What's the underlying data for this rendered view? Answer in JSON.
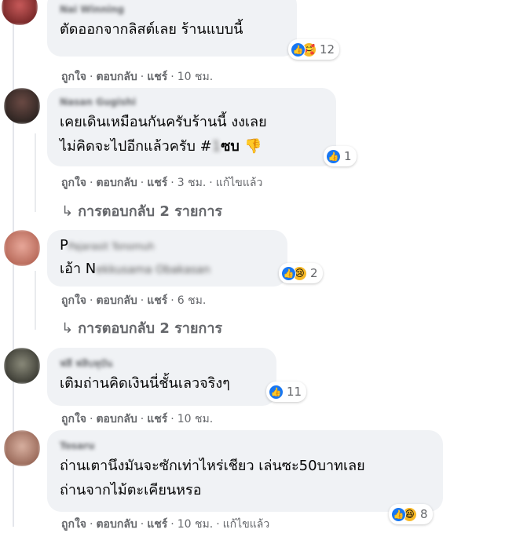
{
  "comments": [
    {
      "author": "Nai Winning",
      "text_lines": [
        "ตัดออกจากลิสต์เลย ร้านแบบนี้"
      ],
      "reaction_count": "12",
      "reaction_emoji": "🥰",
      "actions": {
        "like": "ถูกใจ",
        "reply": "ตอบกลับ",
        "share": "แชร์",
        "time": "10 ชม."
      }
    },
    {
      "author": "Nasan Gugishi",
      "text_lines": [
        "เคยเดินเหมือนกันครับร้านนี้ งงเลย",
        "ไม่คิดจะไปอีกแล้วครับ #"
      ],
      "text_blurred": "1",
      "text_tail": "ซบ 👎",
      "reaction_count": "1",
      "actions": {
        "like": "ถูกใจ",
        "reply": "ตอบกลับ",
        "share": "แชร์",
        "time": "3 ชม.",
        "edited": "แก้ไขแล้ว"
      },
      "replies_label": "การตอบกลับ 2 รายการ"
    },
    {
      "author": "Pajarasit Tonomuh",
      "author_visible_initial": "P",
      "text_prefix": "เอ้า N",
      "text_blurred": "ekkusama Obakasan",
      "reaction_count": "2",
      "reaction_emoji": "😢",
      "actions": {
        "like": "ถูกใจ",
        "reply": "ตอบกลับ",
        "share": "แชร์",
        "time": "6 ชม."
      },
      "replies_label": "การตอบกลับ 2 รายการ"
    },
    {
      "author": "ฟลี ฟลิบหุบัน",
      "text_lines": [
        "เติมถ่านคิดเงินนี่ชั้นเลวจริงๆ"
      ],
      "reaction_count": "11",
      "actions": {
        "like": "ถูกใจ",
        "reply": "ตอบกลับ",
        "share": "แชร์",
        "time": "10 ชม."
      }
    },
    {
      "author": "Tosaru",
      "text_lines": [
        "ถ่านเตานึงมันจะซักเท่าไหร่เชียว เล่นซะ50บาทเลย",
        "ถ่านจากไม้ตะเคียนหรอ"
      ],
      "reaction_count": "8",
      "reaction_emoji": "😆",
      "actions": {
        "like": "ถูกใจ",
        "reply": "ตอบกลับ",
        "share": "แชร์",
        "time": "10 ชม.",
        "edited": "แก้ไขแล้ว"
      }
    }
  ],
  "colors": {
    "bubble": "#f0f2f5",
    "secondary_text": "#65676b",
    "like_blue": "#1877f2"
  }
}
